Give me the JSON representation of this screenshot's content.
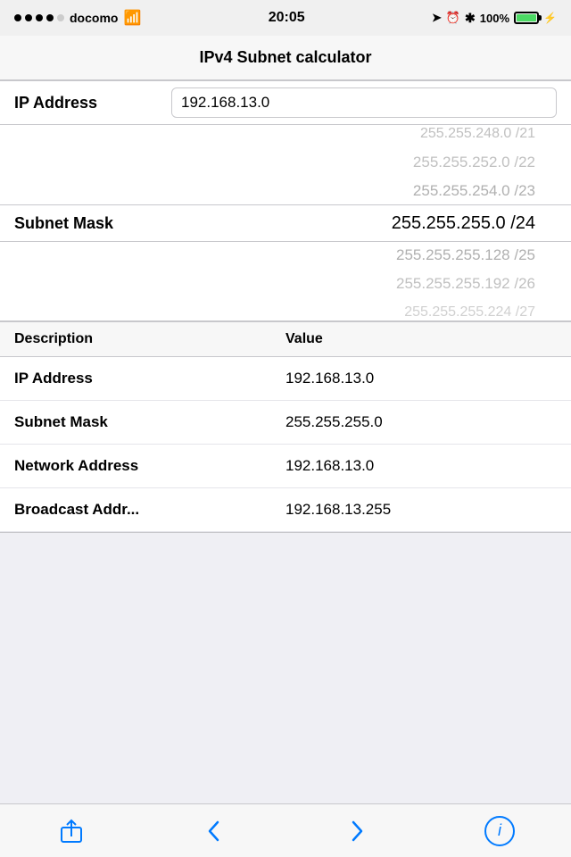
{
  "status": {
    "carrier": "docomo",
    "time": "20:05",
    "battery_pct": "100%"
  },
  "nav": {
    "title": "IPv4 Subnet calculator"
  },
  "ip_address_field": {
    "label": "IP Address",
    "value": "192.168.13.0",
    "placeholder": "192.168.13.0"
  },
  "subnet_picker": {
    "label": "Subnet Mask",
    "items": [
      {
        "mask": "255.255.248.0",
        "cidr": "/21",
        "state": "above2"
      },
      {
        "mask": "255.255.252.0",
        "cidr": "/22",
        "state": "above1"
      },
      {
        "mask": "255.255.254.0",
        "cidr": "/23",
        "state": "near"
      },
      {
        "mask": "255.255.255.0",
        "cidr": "/24",
        "state": "selected"
      },
      {
        "mask": "255.255.255.128",
        "cidr": "/25",
        "state": "below1"
      },
      {
        "mask": "255.255.255.192",
        "cidr": "/26",
        "state": "below2"
      },
      {
        "mask": "255.255.255.224",
        "cidr": "/27",
        "state": "below3"
      }
    ]
  },
  "results": {
    "col_desc": "Description",
    "col_val": "Value",
    "rows": [
      {
        "desc": "IP Address",
        "val": "192.168.13.0"
      },
      {
        "desc": "Subnet Mask",
        "val": "255.255.255.0"
      },
      {
        "desc": "Network Address",
        "val": "192.168.13.0"
      },
      {
        "desc": "Broadcast Addr...",
        "val": "192.168.13.255"
      }
    ]
  },
  "toolbar": {
    "share_label": "Share",
    "back_label": "Back",
    "forward_label": "Forward",
    "info_label": "Info"
  },
  "icons": {
    "share": "share-icon",
    "back": "chevron-left-icon",
    "forward": "chevron-right-icon",
    "info": "info-icon"
  }
}
